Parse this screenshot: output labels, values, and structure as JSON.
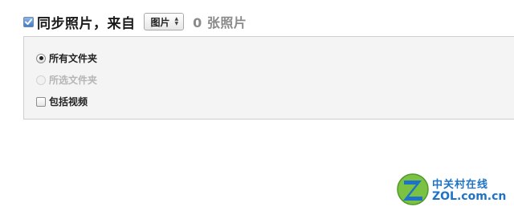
{
  "header": {
    "sync_label": "同步照片，来自",
    "source_value": "图片",
    "photo_count": "0 张照片"
  },
  "options": {
    "all_folders": "所有文件夹",
    "selected_folders": "所选文件夹",
    "include_videos": "包括视频"
  },
  "watermark": {
    "brand_cn": "中关村在线",
    "brand_en": "ZOL.com.cn"
  },
  "colors": {
    "brand": "#1e73c8"
  }
}
